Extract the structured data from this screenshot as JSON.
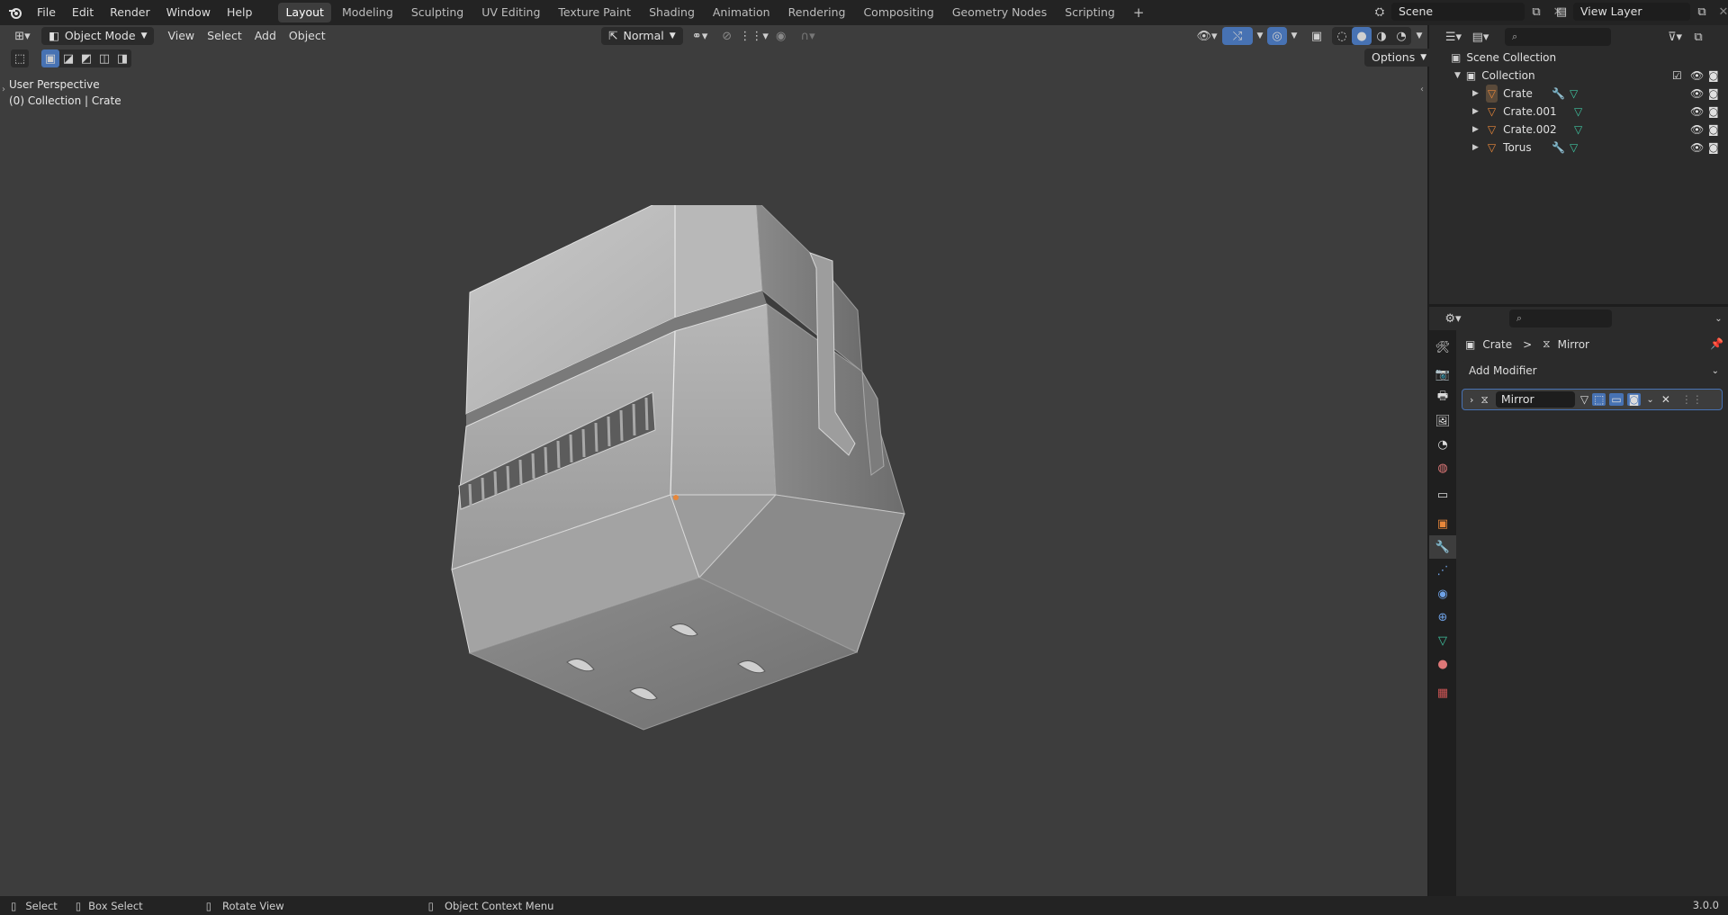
{
  "topbar": {
    "menus": [
      "File",
      "Edit",
      "Render",
      "Window",
      "Help"
    ],
    "workspaces": [
      "Layout",
      "Modeling",
      "Sculpting",
      "UV Editing",
      "Texture Paint",
      "Shading",
      "Animation",
      "Rendering",
      "Compositing",
      "Geometry Nodes",
      "Scripting"
    ],
    "active_workspace": "Layout",
    "add_workspace": "+",
    "scene": "Scene",
    "view_layer": "View Layer"
  },
  "viewport": {
    "mode": "Object Mode",
    "menus": [
      "View",
      "Select",
      "Add",
      "Object"
    ],
    "transform_orientation": "Normal",
    "options": "Options",
    "overlay_line1": "User Perspective",
    "overlay_line2": "(0) Collection | Crate"
  },
  "outliner": {
    "scene_collection": "Scene Collection",
    "collection": "Collection",
    "objects": [
      {
        "name": "Crate",
        "modifier": true
      },
      {
        "name": "Crate.001",
        "modifier": false
      },
      {
        "name": "Crate.002",
        "modifier": false
      },
      {
        "name": "Torus",
        "modifier": true
      }
    ]
  },
  "properties": {
    "breadcrumb_object": "Crate",
    "breadcrumb_sep": ">",
    "breadcrumb_modifier": "Mirror",
    "add_modifier": "Add Modifier",
    "modifier_name": "Mirror"
  },
  "statusbar": {
    "select": "Select",
    "box_select": "Box Select",
    "rotate_view": "Rotate View",
    "context_menu": "Object Context Menu",
    "version": "3.0.0"
  },
  "colors": {
    "accent": "#4772b3",
    "object_orange": "#e8873a",
    "mesh_green": "#3fc4a0",
    "modifier_blue": "#6ea1e6"
  }
}
